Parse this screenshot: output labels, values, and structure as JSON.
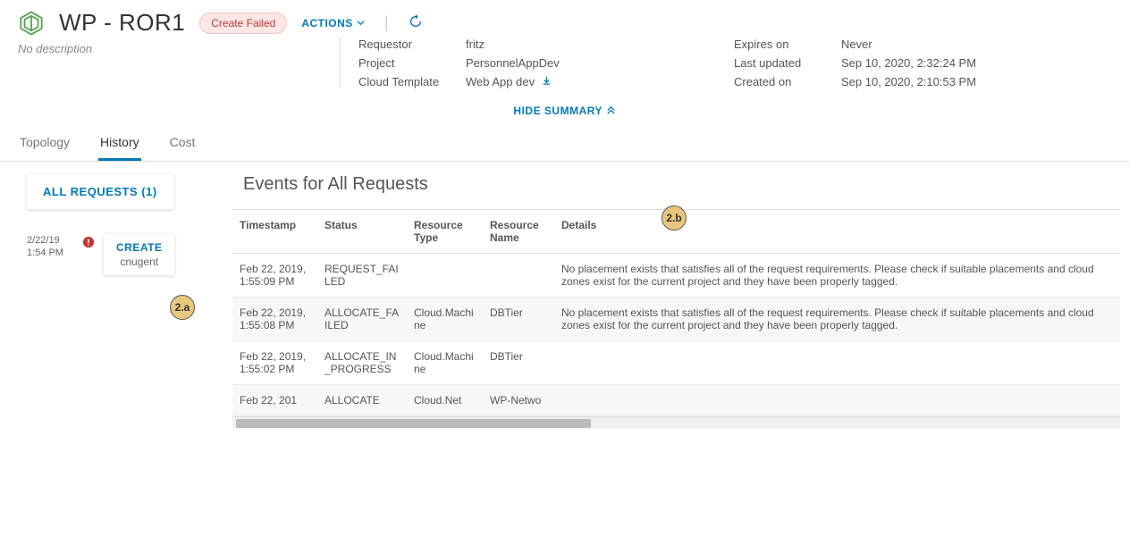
{
  "header": {
    "title": "WP - ROR1",
    "subtitle": "No description",
    "status_badge": "Create Failed",
    "actions_label": "ACTIONS",
    "info_left": [
      {
        "label": "Requestor",
        "value": "fritz"
      },
      {
        "label": "Project",
        "value": "PersonnelAppDev"
      },
      {
        "label": "Cloud Template",
        "value": "Web App dev"
      }
    ],
    "info_right": [
      {
        "label": "Expires on",
        "value": "Never"
      },
      {
        "label": "Last updated",
        "value": "Sep 10, 2020, 2:32:24 PM"
      },
      {
        "label": "Created on",
        "value": "Sep 10, 2020, 2:10:53 PM"
      }
    ],
    "hide_summary": "HIDE SUMMARY"
  },
  "tabs": {
    "topology": "Topology",
    "history": "History",
    "cost": "Cost"
  },
  "sidebar": {
    "all_requests": "ALL REQUESTS (1)",
    "request": {
      "date_line1": "2/22/19",
      "date_line2": "1:54 PM",
      "action": "CREATE",
      "user": "cnugent"
    }
  },
  "annotations": {
    "a": "2.a",
    "b": "2.b"
  },
  "events": {
    "title": "Events for All Requests",
    "columns": {
      "timestamp": "Timestamp",
      "status": "Status",
      "rtype": "Resource Type",
      "rname": "Resource Name",
      "details": "Details"
    },
    "rows": [
      {
        "timestamp": "Feb 22, 2019, 1:55:09 PM",
        "status": "REQUEST_FAILED",
        "rtype": "",
        "rname": "",
        "details": "No placement exists that satisfies all of the request requirements. Please check if suitable placements and cloud zones exist for the current project and they have been properly tagged."
      },
      {
        "timestamp": "Feb 22, 2019, 1:55:08 PM",
        "status": "ALLOCATE_FAILED",
        "rtype": "Cloud.Machine",
        "rname": "DBTier",
        "details": "No placement exists that satisfies all of the request requirements. Please check if suitable placements and cloud zones exist for the current project and they have been properly tagged."
      },
      {
        "timestamp": "Feb 22, 2019, 1:55:02 PM",
        "status": "ALLOCATE_IN_PROGRESS",
        "rtype": "Cloud.Machine",
        "rname": "DBTier",
        "details": ""
      },
      {
        "timestamp": "Feb 22, 201",
        "status": "ALLOCATE",
        "rtype": "Cloud.Net",
        "rname": "WP-Netwo",
        "details": ""
      }
    ]
  }
}
